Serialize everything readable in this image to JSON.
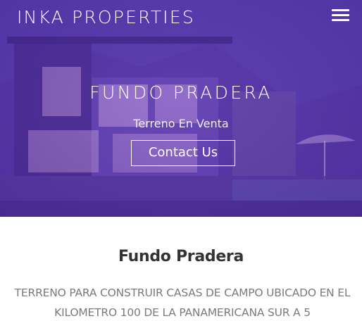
{
  "header": {
    "brand": "INKA PROPERTIES",
    "menu_icon": "hamburger-menu-icon"
  },
  "hero": {
    "title": "FUNDO PRADERA",
    "subtitle": "Terreno En Venta",
    "cta_label": "Contact Us",
    "overlay_color": "#5b3fb0"
  },
  "content": {
    "title": "Fundo Pradera",
    "description": "TERRENO PARA CONSTRUIR CASAS DE CAMPO UBICADO EN EL KILOMETRO 100 DE LA PANAMERICANA SUR A 5"
  },
  "colors": {
    "heading_text": "#333333",
    "body_text": "#7a7a7a"
  }
}
